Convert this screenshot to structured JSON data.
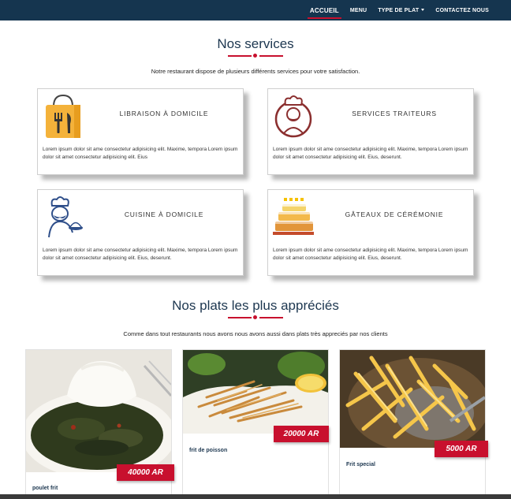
{
  "nav": {
    "items": [
      {
        "label": "ACCUEIL",
        "active": true
      },
      {
        "label": "MENU",
        "active": false
      },
      {
        "label": "TYPE DE PLAT",
        "active": false,
        "dropdown": true
      },
      {
        "label": "CONTACTEZ NOUS",
        "active": false
      }
    ]
  },
  "services": {
    "title": "Nos services",
    "subtitle": "Notre restaurant dispose de plusieurs différents services pour votre satisfaction.",
    "cards": [
      {
        "title": "LIBRAISON À DOMICILE",
        "text": "Lorem ipsum dolor sit ame consectetur adipisicing elit. Maxime, tempora Lorem ipsum dolor sit amet consectetur adipisicing elit. Eius",
        "icon": "shopping-bag-icon"
      },
      {
        "title": "SERVICES TRAITEURS",
        "text": "Lorem ipsum dolor sit ame consectetur adipisicing elit. Maxime, tempora Lorem ipsum dolor sit amet consectetur adipisicing elit. Eius, deserunt.",
        "icon": "chef-icon"
      },
      {
        "title": "CUISINE À DOMICILE",
        "text": "Lorem ipsum dolor sit ame consectetur adipisicing elit. Maxime, tempora Lorem ipsum dolor sit amet consectetur adipisicing elit. Eius, deserunt.",
        "icon": "chef-serving-icon"
      },
      {
        "title": "GÂTEAUX DE CÉRÉMONIE",
        "text": "Lorem ipsum dolor sit ame consectetur adipisicing elit. Maxime, tempora Lorem ipsum dolor sit amet consectetur adipisicing elit. Eius, deserunt.",
        "icon": "cake-icon"
      }
    ]
  },
  "dishes": {
    "title": "Nos plats les plus appréciés",
    "subtitle": "Comme dans tout restaurants nous avons nous avons aussi dans plats très appreciés par nos clients",
    "items": [
      {
        "name": "poulet frit",
        "price": "40000 AR"
      },
      {
        "name": "frit de poisson",
        "price": "20000 AR"
      },
      {
        "name": "Frit special",
        "price": "5000 AR"
      }
    ]
  },
  "colors": {
    "navbar": "#15354f",
    "accent": "#c8102e",
    "title": "#1d3750"
  }
}
